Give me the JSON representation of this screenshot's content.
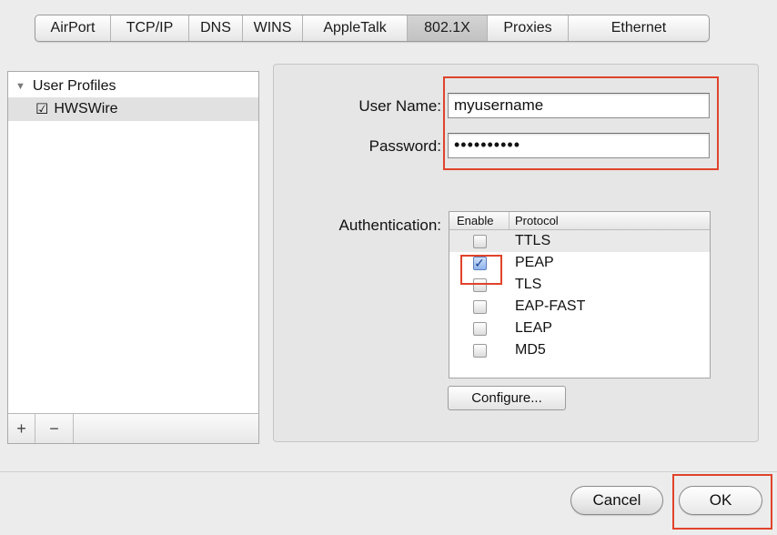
{
  "tabs": [
    {
      "label": "AirPort",
      "selected": false
    },
    {
      "label": "TCP/IP",
      "selected": false
    },
    {
      "label": "DNS",
      "selected": false
    },
    {
      "label": "WINS",
      "selected": false
    },
    {
      "label": "AppleTalk",
      "selected": false
    },
    {
      "label": "802.1X",
      "selected": true
    },
    {
      "label": "Proxies",
      "selected": false
    },
    {
      "label": "Ethernet",
      "selected": false
    }
  ],
  "profiles": {
    "header": "User Profiles",
    "items": [
      {
        "label": "HWSWire",
        "checked": true
      }
    ],
    "add_label": "+",
    "remove_label": "−"
  },
  "form": {
    "username_label": "User Name:",
    "username_value": "myusername",
    "password_label": "Password:",
    "password_value": "••••••••••",
    "auth_label": "Authentication:"
  },
  "auth_table": {
    "col_enable": "Enable",
    "col_protocol": "Protocol",
    "rows": [
      {
        "protocol": "TTLS",
        "enabled": false,
        "selected": true
      },
      {
        "protocol": "PEAP",
        "enabled": true,
        "selected": false
      },
      {
        "protocol": "TLS",
        "enabled": false,
        "selected": false
      },
      {
        "protocol": "EAP-FAST",
        "enabled": false,
        "selected": false
      },
      {
        "protocol": "LEAP",
        "enabled": false,
        "selected": false
      },
      {
        "protocol": "MD5",
        "enabled": false,
        "selected": false
      }
    ]
  },
  "buttons": {
    "configure": "Configure...",
    "cancel": "Cancel",
    "ok": "OK"
  },
  "colors": {
    "highlight": "#e0432b",
    "checkbox_checked": "#8fb4ec"
  }
}
